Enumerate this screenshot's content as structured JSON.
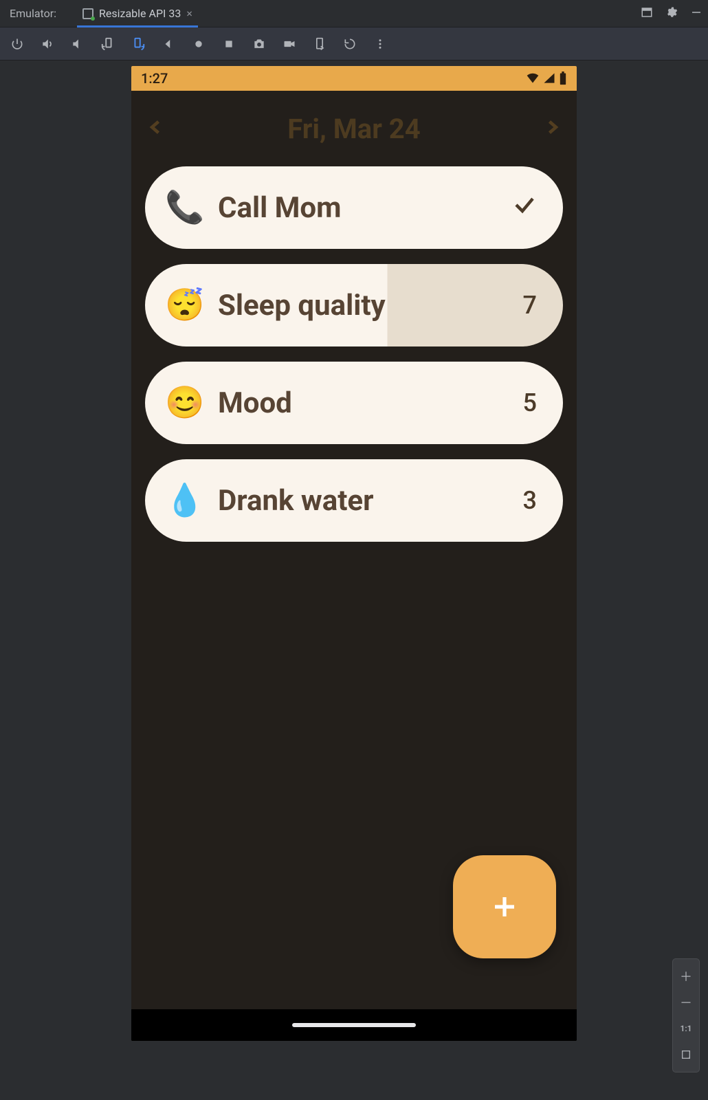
{
  "ide": {
    "panel_label": "Emulator:",
    "tab_label": "Resizable API 33"
  },
  "device": {
    "status_time": "1:27",
    "date_title": "Fri, Mar 24",
    "items": [
      {
        "icon": "📞",
        "label": "Call Mom",
        "trailing": "check",
        "partial": false
      },
      {
        "icon": "😴",
        "label": "Sleep quality",
        "trailing": "7",
        "partial": true
      },
      {
        "icon": "😊",
        "label": "Mood",
        "trailing": "5",
        "partial": false
      },
      {
        "icon": "💧",
        "label": "Drank water",
        "trailing": "3",
        "partial": false
      }
    ]
  },
  "zoom": {
    "one_to_one": "1:1"
  }
}
